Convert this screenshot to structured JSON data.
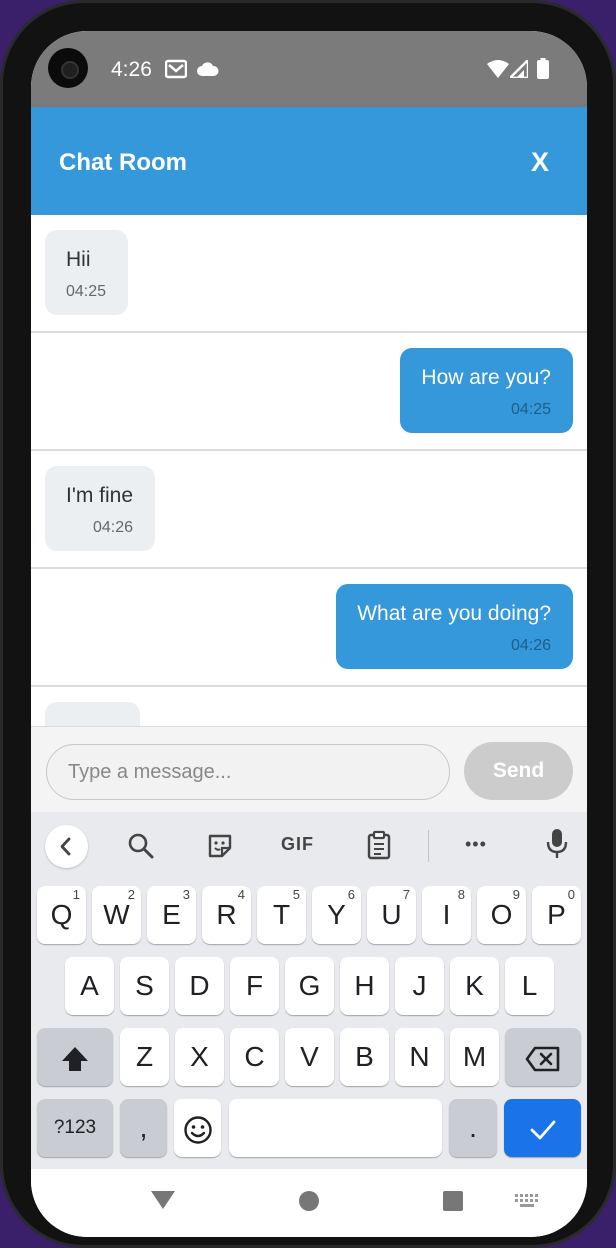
{
  "status_bar": {
    "time": "4:26",
    "left_icons": [
      "gmail-icon",
      "cloud-icon"
    ],
    "right_icons": [
      "wifi-icon",
      "signal-icon",
      "battery-icon"
    ]
  },
  "header": {
    "title": "Chat Room",
    "close_label": "X",
    "color": "#3498db"
  },
  "messages": [
    {
      "direction": "in",
      "text": "Hii",
      "time": "04:25"
    },
    {
      "direction": "out",
      "text": "How are you?",
      "time": "04:25"
    },
    {
      "direction": "in",
      "text": "I'm fine",
      "time": "04:26"
    },
    {
      "direction": "out",
      "text": "What are you doing?",
      "time": "04:26"
    }
  ],
  "input": {
    "placeholder": "Type a message...",
    "value": "",
    "send_label": "Send"
  },
  "keyboard": {
    "toolbar": [
      "back-icon",
      "search-icon",
      "sticker-icon",
      "gif-icon",
      "clipboard-icon",
      "more-icon",
      "mic-icon"
    ],
    "gif_label": "GIF",
    "more_label": "•••",
    "row1": [
      {
        "label": "Q",
        "hint": "1"
      },
      {
        "label": "W",
        "hint": "2"
      },
      {
        "label": "E",
        "hint": "3"
      },
      {
        "label": "R",
        "hint": "4"
      },
      {
        "label": "T",
        "hint": "5"
      },
      {
        "label": "Y",
        "hint": "6"
      },
      {
        "label": "U",
        "hint": "7"
      },
      {
        "label": "I",
        "hint": "8"
      },
      {
        "label": "O",
        "hint": "9"
      },
      {
        "label": "P",
        "hint": "0"
      }
    ],
    "row2": [
      "A",
      "S",
      "D",
      "F",
      "G",
      "H",
      "J",
      "K",
      "L"
    ],
    "row3": [
      "Z",
      "X",
      "C",
      "V",
      "B",
      "N",
      "M"
    ],
    "symbols_label": "?123",
    "comma_label": ",",
    "period_label": ".",
    "enter_color": "#1a73e8"
  },
  "nav_bar": {
    "icons": [
      "back-triangle-icon",
      "home-circle-icon",
      "recents-square-icon",
      "keyboard-switch-icon"
    ]
  }
}
